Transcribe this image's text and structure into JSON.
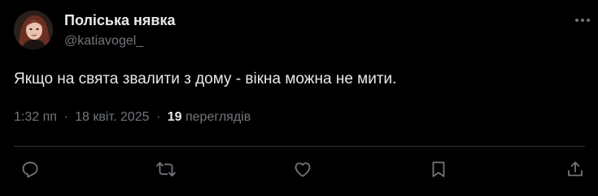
{
  "tweet": {
    "author": {
      "display_name": "Поліська нявка",
      "handle": "@katiavogel_",
      "avatar": "avatar-photo"
    },
    "text": "Якщо на свята звалити з дому - вікна можна не мити.",
    "time": "1:32 пп",
    "separator": "·",
    "date": "18 квіт. 2025",
    "views_count": "19",
    "views_label": "переглядів"
  },
  "actions": [
    {
      "name": "reply",
      "icon": "reply-icon"
    },
    {
      "name": "repost",
      "icon": "repost-icon"
    },
    {
      "name": "like",
      "icon": "like-icon"
    },
    {
      "name": "bookmark",
      "icon": "bookmark-icon"
    },
    {
      "name": "share",
      "icon": "share-icon"
    }
  ],
  "more_icon": "more-icon",
  "colors": {
    "background": "#000000",
    "primary_text": "#e7e9ea",
    "secondary_text": "#71767b",
    "divider": "#2f3336"
  }
}
